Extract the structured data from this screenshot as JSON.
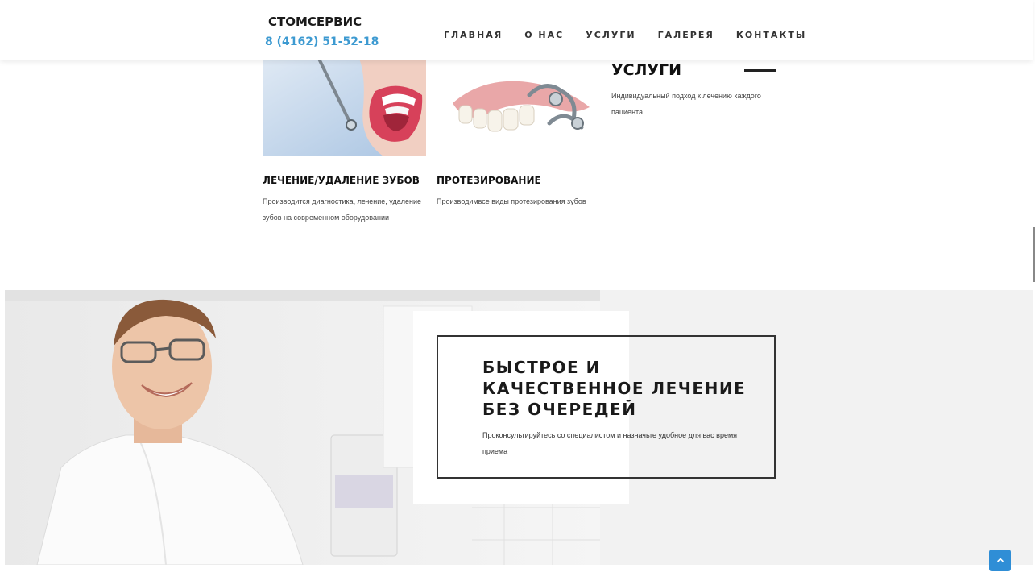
{
  "header": {
    "brand_name": "СТОМСЕРВИС",
    "phone": "8 (4162) 51-52-18",
    "nav": [
      "ГЛАВНАЯ",
      "О НАС",
      "УСЛУГИ",
      "ГАЛЕРЕЯ",
      "КОНТАКТЫ"
    ]
  },
  "services": {
    "section_title": "УСЛУГИ",
    "section_desc": "Индивидуальный подход к лечению каждого пациента.",
    "items": [
      {
        "title": "ЛЕЧЕНИЕ/УДАЛЕНИЕ ЗУБОВ",
        "desc": "Производится диагностика, лечение, удаление зубов на современном оборудовании"
      },
      {
        "title": "ПРОТЕЗИРОВАНИЕ",
        "desc": "Производимвсе виды протезирования зубов"
      }
    ]
  },
  "hero": {
    "title": "БЫСТРОЕ И КАЧЕСТВЕННОЕ ЛЕЧЕНИЕ БЕЗ ОЧЕРЕДЕЙ",
    "desc": "Проконсультируйтесь со специалистом и назначьте удобное для вас время приема"
  },
  "colors": {
    "accent": "#3d9ad1",
    "back_to_top": "#2f8ed6"
  },
  "icons": {
    "back_to_top": "chevron-up-icon"
  }
}
